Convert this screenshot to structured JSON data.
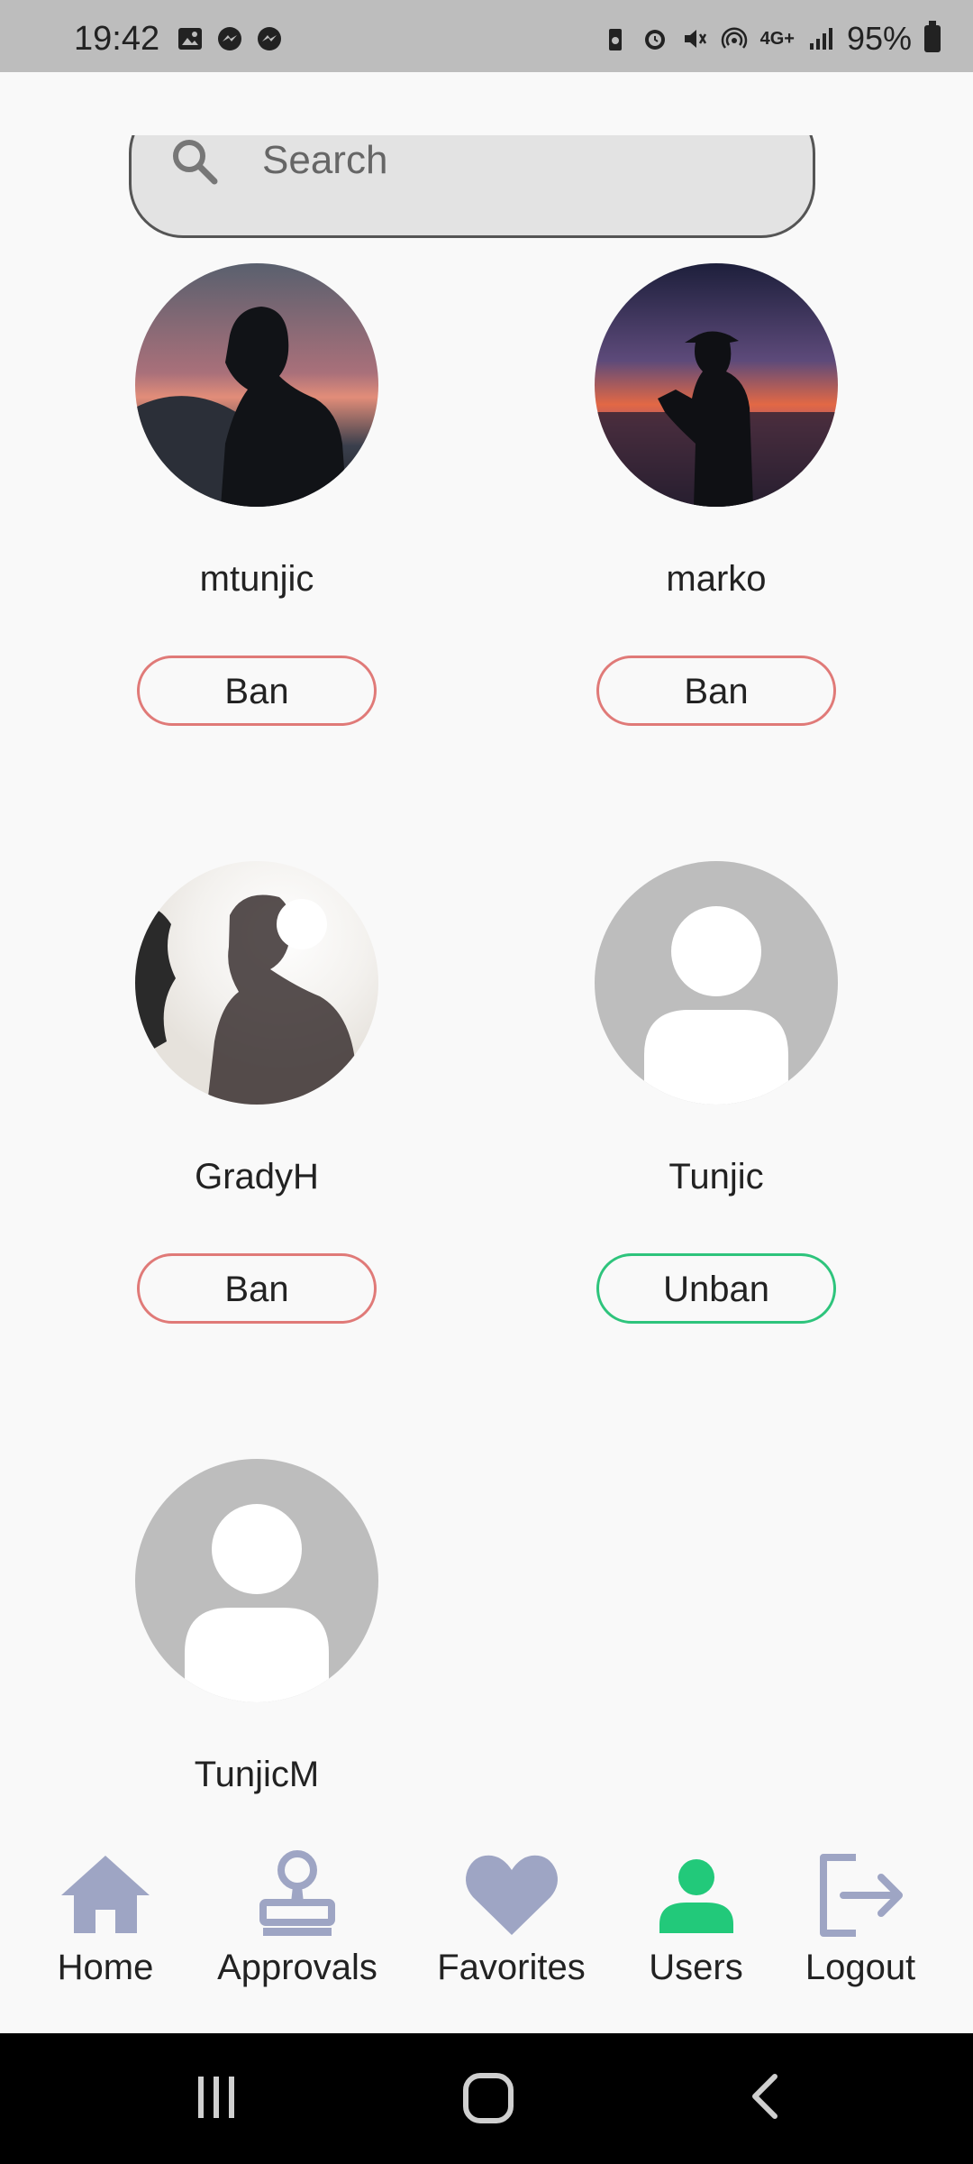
{
  "status_bar": {
    "time": "19:42",
    "battery": "95%",
    "network": "4G+"
  },
  "search": {
    "placeholder": "Search"
  },
  "users": [
    {
      "name": "mtunjic",
      "action": "Ban",
      "avatar": "photo-sunset-silhouette",
      "action_color": "#e07a78"
    },
    {
      "name": "marko",
      "action": "Ban",
      "avatar": "photo-beach-silhouette",
      "action_color": "#e07a78"
    },
    {
      "name": "GradyH",
      "action": "Ban",
      "avatar": "photo-backlit-portrait",
      "action_color": "#e07a78"
    },
    {
      "name": "Tunjic",
      "action": "Unban",
      "avatar": "default-person",
      "action_color": "#2ec47c"
    },
    {
      "name": "TunjicM",
      "action": "",
      "avatar": "default-person"
    }
  ],
  "bottom_nav": {
    "items": [
      {
        "label": "Home",
        "icon": "home-icon",
        "active": false
      },
      {
        "label": "Approvals",
        "icon": "stamp-icon",
        "active": false
      },
      {
        "label": "Favorites",
        "icon": "heart-icon",
        "active": false
      },
      {
        "label": "Users",
        "icon": "person-icon",
        "active": true
      },
      {
        "label": "Logout",
        "icon": "logout-icon",
        "active": false
      }
    ],
    "inactive_color": "#9ea5c4",
    "active_color": "#22c97a"
  }
}
